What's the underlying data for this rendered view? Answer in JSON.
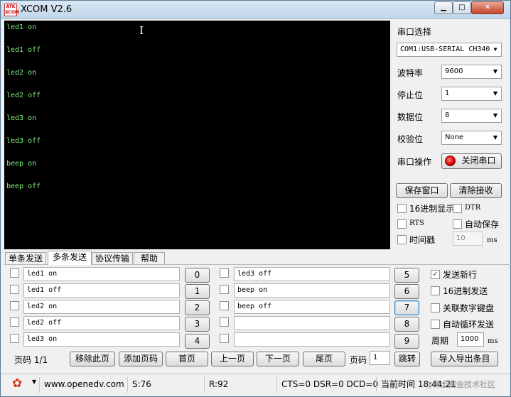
{
  "window": {
    "title": "XCOM V2.6",
    "logo_text": "ATK XCOM"
  },
  "terminal": {
    "lines": [
      "led1 on",
      "led1 off",
      "led2 on",
      "led2 off",
      "led3 on",
      "led3 off",
      "beep on",
      "beep off"
    ]
  },
  "serial": {
    "port_select_label": "串口选择",
    "port_value": "COM1:USB-SERIAL CH340",
    "baud_label": "波特率",
    "baud_value": "9600",
    "stop_label": "停止位",
    "stop_value": "1",
    "data_label": "数据位",
    "data_value": "8",
    "parity_label": "校验位",
    "parity_value": "None",
    "op_label": "串口操作",
    "close_port_label": "关闭串口"
  },
  "receive": {
    "save_window_label": "保存窗口",
    "clear_label": "清除接收",
    "hex_display_label": "16进制显示",
    "dtr_label": "DTR",
    "rts_label": "RTS",
    "autosave_label": "自动保存",
    "timestamp_label": "时间戳",
    "timestamp_value": "10",
    "ms_label": "ms"
  },
  "tabs": [
    "单条发送",
    "多条发送",
    "协议传输",
    "帮助"
  ],
  "multi_send": {
    "left": [
      {
        "text": "led1 on",
        "button": "0"
      },
      {
        "text": "led1 off",
        "button": "1"
      },
      {
        "text": "led2 on",
        "button": "2"
      },
      {
        "text": "led2 off",
        "button": "3"
      },
      {
        "text": "led3 on",
        "button": "4"
      }
    ],
    "right": [
      {
        "text": "led3 off",
        "button": "5"
      },
      {
        "text": "beep on",
        "button": "6"
      },
      {
        "text": "beep off",
        "button": "7"
      },
      {
        "text": "",
        "button": "8"
      },
      {
        "text": "",
        "button": "9"
      }
    ],
    "options": {
      "newline_label": "发送新行",
      "newline_checked": "✓",
      "hex_send_label": "16进制发送",
      "numpad_label": "关联数字键盘",
      "loop_label": "自动循环发送",
      "period_label": "周期",
      "period_value": "1000",
      "period_unit": "ms"
    },
    "pager": {
      "page_label": "页码 1/1",
      "remove_label": "移除此页",
      "add_label": "添加页码",
      "first_label": "首页",
      "prev_label": "上一页",
      "next_label": "下一页",
      "last_label": "尾页",
      "page_input_label": "页码",
      "page_input_value": "1",
      "jump_label": "跳转",
      "import_export_label": "导入导出条目"
    }
  },
  "statusbar": {
    "url": "www.openedv.com",
    "sent": "S:76",
    "received": "R:92",
    "signals": "CTS=0 DSR=0 DCD=0",
    "time": "当前时间 18:44:21",
    "watermark": "@稀土掘金技术社区"
  },
  "colors": {
    "terminal_bg": "#000000",
    "terminal_fg": "#7fef7f",
    "accent_red": "#d23b1c"
  }
}
